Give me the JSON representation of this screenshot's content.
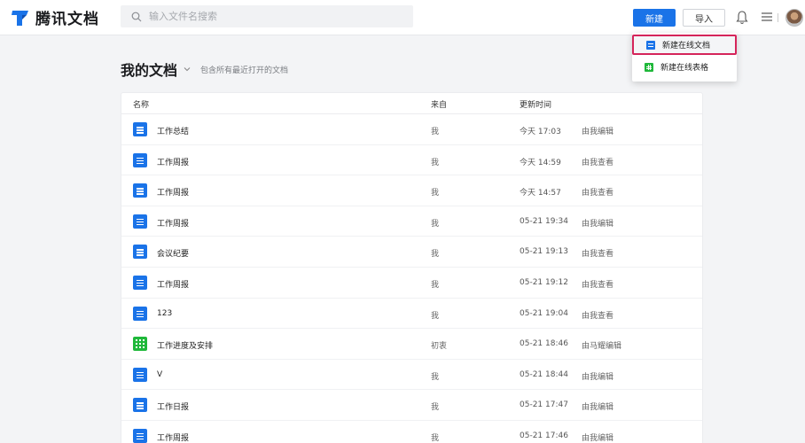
{
  "app": {
    "logo_text": "腾讯文档"
  },
  "search": {
    "placeholder": "输入文件名搜索"
  },
  "toolbar": {
    "new_label": "新建",
    "import_label": "导入"
  },
  "page": {
    "title": "我的文档",
    "subtitle": "包含所有最近打开的文档"
  },
  "columns": {
    "name": "名称",
    "from": "来自",
    "updated": "更新时间"
  },
  "rows": [
    {
      "icon": "doc-icon",
      "name": "工作总结",
      "from": "我",
      "time": "今天 17:03",
      "action": "由我编辑"
    },
    {
      "icon": "doc-icon",
      "name": "工作周报",
      "from": "我",
      "time": "今天 14:59",
      "action": "由我查看"
    },
    {
      "icon": "doc-icon",
      "name": "工作周报",
      "from": "我",
      "time": "今天 14:57",
      "action": "由我查看"
    },
    {
      "icon": "doc-icon",
      "name": "工作周报",
      "from": "我",
      "time": "05-21 19:34",
      "action": "由我编辑"
    },
    {
      "icon": "doc-icon",
      "name": "会议纪要",
      "from": "我",
      "time": "05-21 19:13",
      "action": "由我查看"
    },
    {
      "icon": "doc-icon",
      "name": "工作周报",
      "from": "我",
      "time": "05-21 19:12",
      "action": "由我查看"
    },
    {
      "icon": "doc-icon",
      "name": "123",
      "from": "我",
      "time": "05-21 19:04",
      "action": "由我查看"
    },
    {
      "icon": "sheet-icon",
      "name": "工作进度及安排",
      "from": "初衷",
      "time": "05-21 18:46",
      "action": "由马耀编辑"
    },
    {
      "icon": "doc-icon",
      "name": "V",
      "from": "我",
      "time": "05-21 18:44",
      "action": "由我编辑"
    },
    {
      "icon": "doc-icon",
      "name": "工作日报",
      "from": "我",
      "time": "05-21 17:47",
      "action": "由我编辑"
    },
    {
      "icon": "doc-icon",
      "name": "工作周报",
      "from": "我",
      "time": "05-21 17:46",
      "action": "由我编辑"
    }
  ],
  "dropdown": {
    "items": [
      {
        "icon": "doc-icon",
        "label": "新建在线文档",
        "highlighted": true
      },
      {
        "icon": "sheet-icon",
        "label": "新建在线表格",
        "highlighted": false
      }
    ]
  },
  "colors": {
    "accent": "#1a73e8",
    "sheet": "#1fb83a",
    "highlight_border": "#d5245a"
  }
}
